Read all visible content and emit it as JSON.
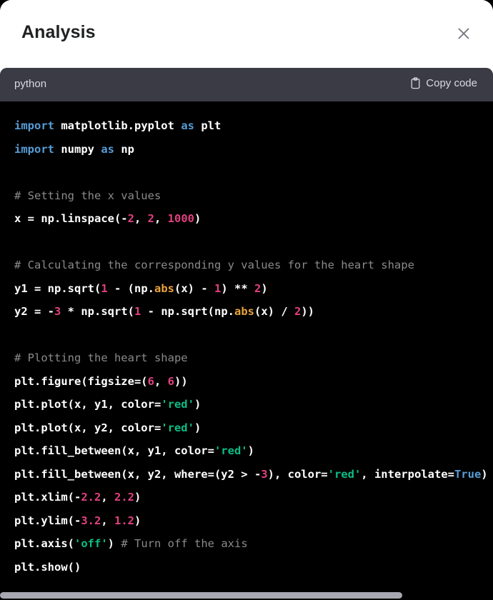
{
  "panel": {
    "title": "Analysis",
    "close_icon": "close-icon"
  },
  "code_block": {
    "language": "python",
    "copy_label": "Copy code",
    "copy_icon": "clipboard-icon",
    "colors": {
      "header_bg": "#3b3b46",
      "code_bg": "#000000",
      "keyword": "#569cd6",
      "number": "#e0407f",
      "string": "#0bbd85",
      "comment": "#8a8a8a",
      "builtin": "#e8a33d",
      "plain": "#ffffff",
      "scrollbar": "#a8a8b2"
    },
    "lines": [
      [
        {
          "t": "import",
          "c": "kw"
        },
        {
          "t": " matplotlib.pyplot ",
          "c": "pl"
        },
        {
          "t": "as",
          "c": "kw"
        },
        {
          "t": " plt",
          "c": "pl"
        }
      ],
      [
        {
          "t": "import",
          "c": "kw"
        },
        {
          "t": " numpy ",
          "c": "pl"
        },
        {
          "t": "as",
          "c": "kw"
        },
        {
          "t": " np",
          "c": "pl"
        }
      ],
      [],
      [
        {
          "t": "# Setting the x values",
          "c": "com"
        }
      ],
      [
        {
          "t": "x = np.linspace(-",
          "c": "pl"
        },
        {
          "t": "2",
          "c": "num"
        },
        {
          "t": ", ",
          "c": "pl"
        },
        {
          "t": "2",
          "c": "num"
        },
        {
          "t": ", ",
          "c": "pl"
        },
        {
          "t": "1000",
          "c": "num"
        },
        {
          "t": ")",
          "c": "pl"
        }
      ],
      [],
      [
        {
          "t": "# Calculating the corresponding y values for the heart shape",
          "c": "com"
        }
      ],
      [
        {
          "t": "y1 = np.sqrt(",
          "c": "pl"
        },
        {
          "t": "1",
          "c": "num"
        },
        {
          "t": " - (np.",
          "c": "pl"
        },
        {
          "t": "abs",
          "c": "bi"
        },
        {
          "t": "(x) - ",
          "c": "pl"
        },
        {
          "t": "1",
          "c": "num"
        },
        {
          "t": ") ** ",
          "c": "pl"
        },
        {
          "t": "2",
          "c": "num"
        },
        {
          "t": ")",
          "c": "pl"
        }
      ],
      [
        {
          "t": "y2 = -",
          "c": "pl"
        },
        {
          "t": "3",
          "c": "num"
        },
        {
          "t": " * np.sqrt(",
          "c": "pl"
        },
        {
          "t": "1",
          "c": "num"
        },
        {
          "t": " - np.sqrt(np.",
          "c": "pl"
        },
        {
          "t": "abs",
          "c": "bi"
        },
        {
          "t": "(x) / ",
          "c": "pl"
        },
        {
          "t": "2",
          "c": "num"
        },
        {
          "t": "))",
          "c": "pl"
        }
      ],
      [],
      [
        {
          "t": "# Plotting the heart shape",
          "c": "com"
        }
      ],
      [
        {
          "t": "plt.figure(figsize=(",
          "c": "pl"
        },
        {
          "t": "6",
          "c": "num"
        },
        {
          "t": ", ",
          "c": "pl"
        },
        {
          "t": "6",
          "c": "num"
        },
        {
          "t": "))",
          "c": "pl"
        }
      ],
      [
        {
          "t": "plt.plot(x, y1, color=",
          "c": "pl"
        },
        {
          "t": "'red'",
          "c": "str"
        },
        {
          "t": ")",
          "c": "pl"
        }
      ],
      [
        {
          "t": "plt.plot(x, y2, color=",
          "c": "pl"
        },
        {
          "t": "'red'",
          "c": "str"
        },
        {
          "t": ")",
          "c": "pl"
        }
      ],
      [
        {
          "t": "plt.fill_between(x, y1, color=",
          "c": "pl"
        },
        {
          "t": "'red'",
          "c": "str"
        },
        {
          "t": ")",
          "c": "pl"
        }
      ],
      [
        {
          "t": "plt.fill_between(x, y2, where=(y2 > -",
          "c": "pl"
        },
        {
          "t": "3",
          "c": "num"
        },
        {
          "t": "), color=",
          "c": "pl"
        },
        {
          "t": "'red'",
          "c": "str"
        },
        {
          "t": ", interpolate=",
          "c": "pl"
        },
        {
          "t": "True",
          "c": "kw"
        },
        {
          "t": ")",
          "c": "pl"
        }
      ],
      [
        {
          "t": "plt.xlim(-",
          "c": "pl"
        },
        {
          "t": "2.2",
          "c": "num"
        },
        {
          "t": ", ",
          "c": "pl"
        },
        {
          "t": "2.2",
          "c": "num"
        },
        {
          "t": ")",
          "c": "pl"
        }
      ],
      [
        {
          "t": "plt.ylim(-",
          "c": "pl"
        },
        {
          "t": "3.2",
          "c": "num"
        },
        {
          "t": ", ",
          "c": "pl"
        },
        {
          "t": "1.2",
          "c": "num"
        },
        {
          "t": ")",
          "c": "pl"
        }
      ],
      [
        {
          "t": "plt.axis(",
          "c": "pl"
        },
        {
          "t": "'off'",
          "c": "str"
        },
        {
          "t": ") ",
          "c": "pl"
        },
        {
          "t": "# Turn off the axis",
          "c": "com"
        }
      ],
      [
        {
          "t": "plt.show()",
          "c": "pl"
        }
      ]
    ]
  }
}
